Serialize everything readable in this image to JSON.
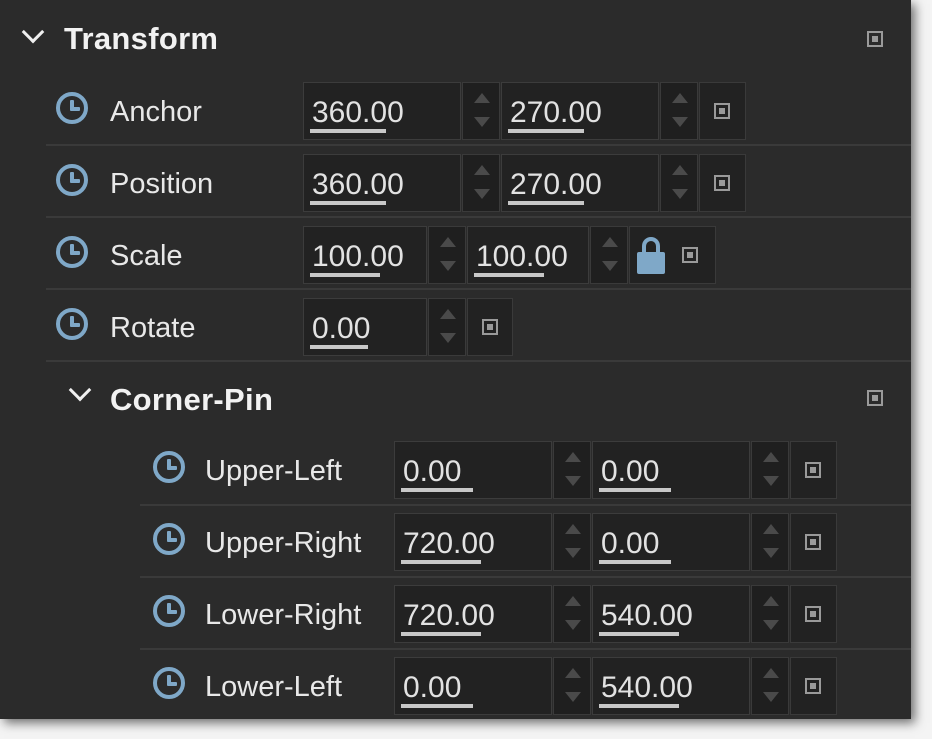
{
  "transform": {
    "title": "Transform",
    "rows": [
      {
        "label": "Anchor",
        "x": "360.00",
        "y": "270.00"
      },
      {
        "label": "Position",
        "x": "360.00",
        "y": "270.00"
      },
      {
        "label": "Scale",
        "x": "100.00",
        "y": "100.00",
        "locked": true
      },
      {
        "label": "Rotate",
        "value": "0.00"
      }
    ]
  },
  "corner_pin": {
    "title": "Corner-Pin",
    "rows": [
      {
        "label": "Upper-Left",
        "x": "0.00",
        "y": "0.00"
      },
      {
        "label": "Upper-Right",
        "x": "720.00",
        "y": "0.00"
      },
      {
        "label": "Lower-Right",
        "x": "720.00",
        "y": "540.00"
      },
      {
        "label": "Lower-Left",
        "x": "0.00",
        "y": "540.00"
      }
    ]
  },
  "icons": [
    "chevron-down-icon",
    "keyframe-clock-icon",
    "spinner-up-icon",
    "spinner-down-icon",
    "reset-icon",
    "lock-icon"
  ],
  "colors": {
    "panel_bg": "#2b2b2b",
    "field_bg": "#222222",
    "accent": "#7fa8c8",
    "text": "#e8e8e8"
  }
}
